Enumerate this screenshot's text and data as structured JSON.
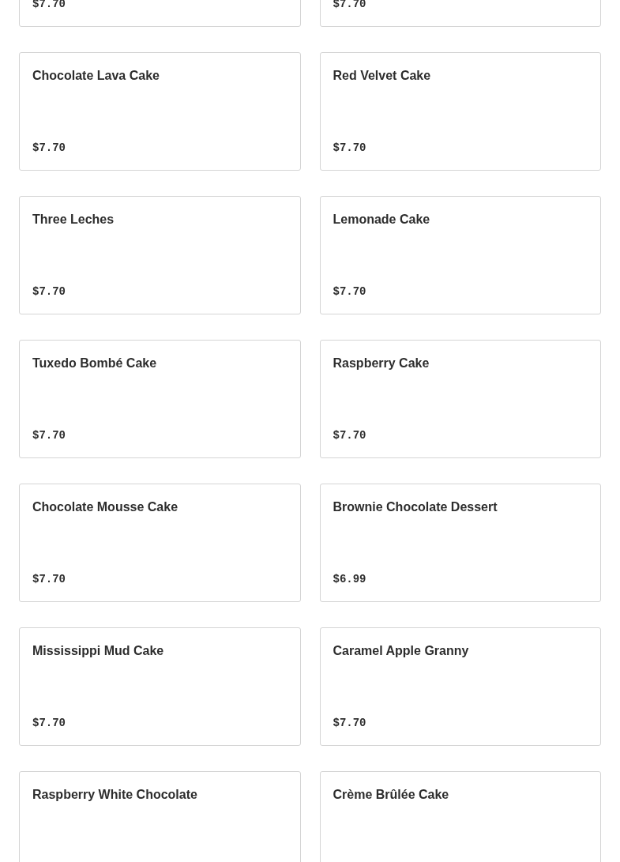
{
  "menu_items": [
    {
      "price": "$7.70"
    },
    {
      "price": "$7.70"
    },
    {
      "name": "Chocolate Lava Cake",
      "price": "$7.70"
    },
    {
      "name": "Red Velvet Cake",
      "price": "$7.70"
    },
    {
      "name": "Three Leches",
      "price": "$7.70"
    },
    {
      "name": "Lemonade Cake",
      "price": "$7.70"
    },
    {
      "name": "Tuxedo Bombé Cake",
      "price": "$7.70"
    },
    {
      "name": "Raspberry Cake",
      "price": "$7.70"
    },
    {
      "name": "Chocolate Mousse Cake",
      "price": "$7.70"
    },
    {
      "name": "Brownie Chocolate Dessert",
      "price": "$6.99"
    },
    {
      "name": "Mississippi Mud Cake",
      "price": "$7.70"
    },
    {
      "name": "Caramel Apple Granny",
      "price": "$7.70"
    },
    {
      "name": "Raspberry White Chocolate"
    },
    {
      "name": "Crème Brûlée Cake"
    }
  ]
}
